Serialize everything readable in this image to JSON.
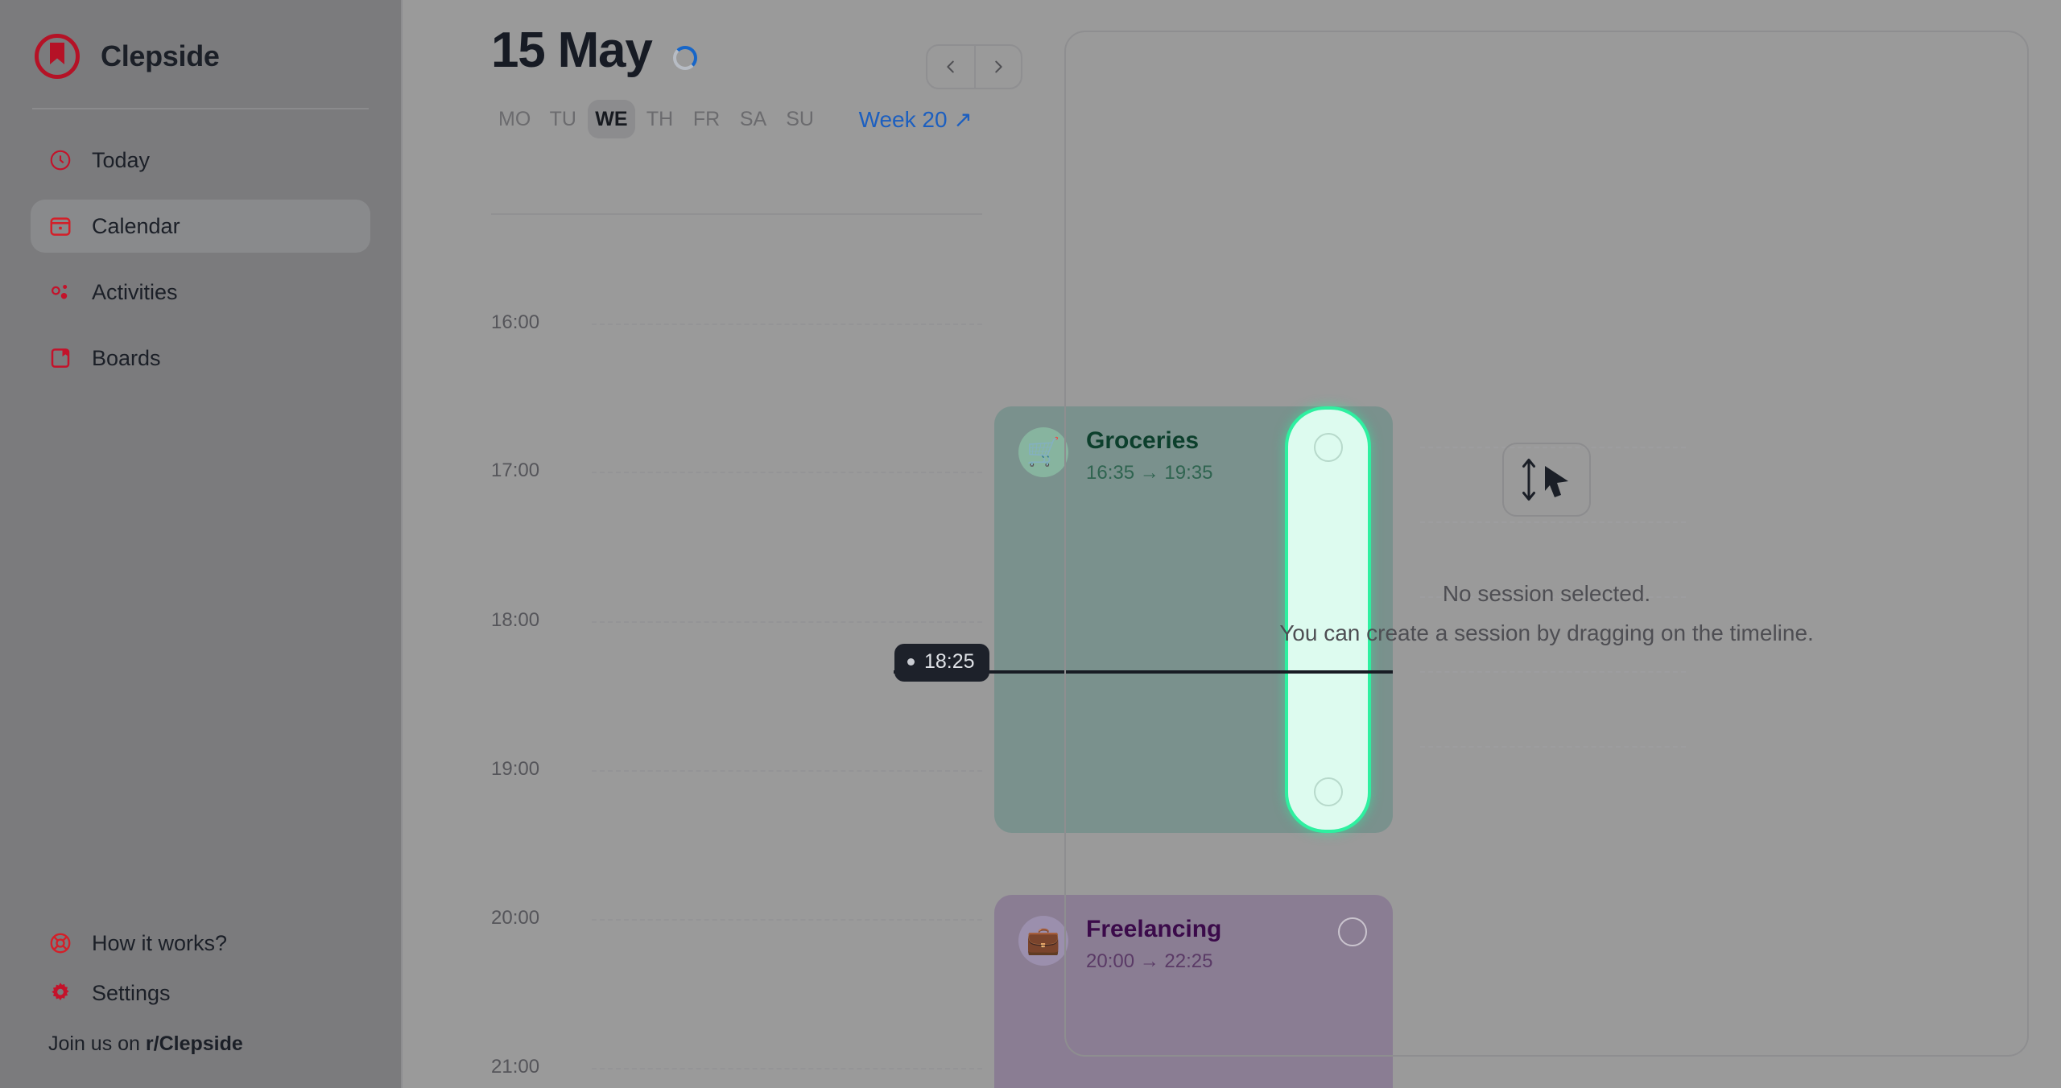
{
  "app": {
    "brand": "Clepside",
    "logo_color": "#b51226"
  },
  "sidebar": {
    "nav": [
      {
        "label": "Today",
        "icon": "clock-icon",
        "active": false
      },
      {
        "label": "Calendar",
        "icon": "calendar-icon",
        "active": true
      },
      {
        "label": "Activities",
        "icon": "activities-icon",
        "active": false
      },
      {
        "label": "Boards",
        "icon": "boards-icon",
        "active": false
      }
    ],
    "footer": [
      {
        "label": "How it works?",
        "icon": "lifebuoy-icon"
      },
      {
        "label": "Settings",
        "icon": "gear-icon"
      }
    ],
    "reddit_prefix": "Join us on ",
    "reddit_handle": "r/Clepside"
  },
  "header": {
    "date_title": "15 May",
    "loading": true,
    "prev_label": "‹",
    "next_label": "›",
    "weekdays": [
      {
        "label": "MO",
        "current": false
      },
      {
        "label": "TU",
        "current": false
      },
      {
        "label": "WE",
        "current": true
      },
      {
        "label": "TH",
        "current": false
      },
      {
        "label": "FR",
        "current": false
      },
      {
        "label": "SA",
        "current": false
      },
      {
        "label": "SU",
        "current": false
      }
    ],
    "week_link": "Week 20 ↗"
  },
  "timeline": {
    "hours": [
      "16:00",
      "17:00",
      "18:00",
      "19:00",
      "20:00",
      "21:00"
    ],
    "now": {
      "time": "18:25",
      "badge_dot": true
    },
    "events": [
      {
        "title": "Groceries",
        "time_range": "16:35 → 19:35",
        "start": "16:35",
        "end": "19:35",
        "emoji": "🛒",
        "bg": "#7a918d",
        "emoji_bg": "#87b49f",
        "title_color": "#0c3f2c",
        "time_color": "#2f6450",
        "selected": true
      },
      {
        "title": "Freelancing",
        "time_range": "20:00 → 22:25",
        "start": "20:00",
        "end": "22:25",
        "emoji": "💼",
        "bg": "#8a7d93",
        "emoji_bg": "#9b8fad",
        "title_color": "#3b0a4a",
        "time_color": "#5a3a66",
        "selected": false
      }
    ],
    "drag_overlay": {
      "fill": "#ddfbef",
      "border": "#2ef0a0"
    }
  },
  "detail": {
    "empty_title": "No session selected.",
    "empty_sub": "You can create a session by dragging on the timeline.",
    "icon": "drag-vertical-cursor-icon"
  }
}
